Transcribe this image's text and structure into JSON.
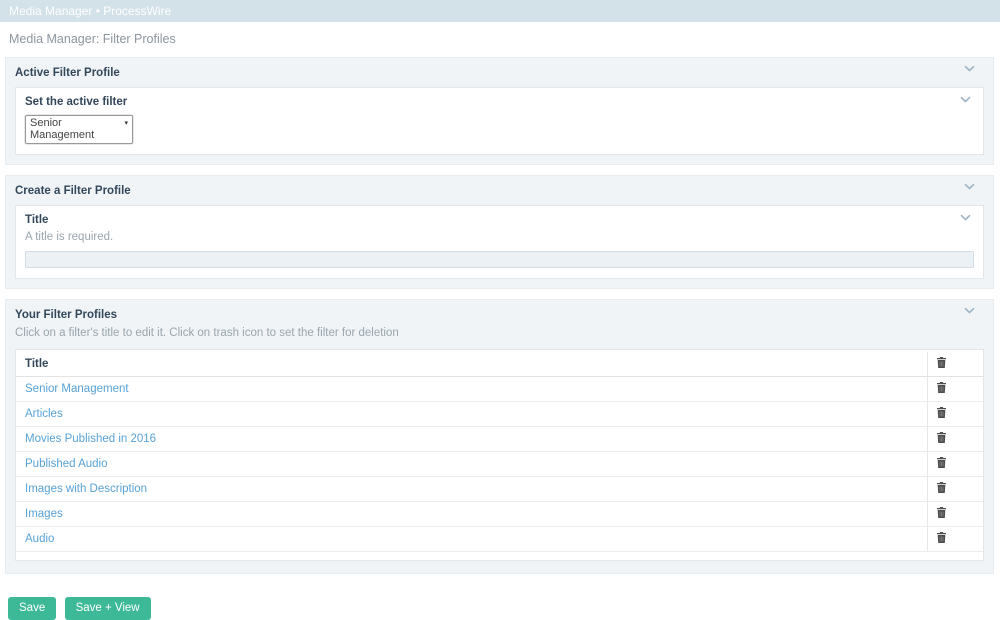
{
  "topbar": {
    "title": "Media Manager • ProcessWire"
  },
  "page": {
    "heading": "Media Manager: Filter Profiles"
  },
  "panels": {
    "active": {
      "title": "Active Filter Profile",
      "field_label": "Set the active filter",
      "select_value": "Senior Management"
    },
    "create": {
      "title": "Create a Filter Profile",
      "field_label": "Title",
      "field_note": "A title is required.",
      "input_value": ""
    },
    "profiles": {
      "title": "Your Filter Profiles",
      "description": "Click on a filter's title to edit it. Click on trash icon to set the filter for deletion",
      "table": {
        "title_header": "Title",
        "rows": [
          {
            "title": "Senior Management"
          },
          {
            "title": "Articles"
          },
          {
            "title": "Movies Published in 2016"
          },
          {
            "title": "Published Audio"
          },
          {
            "title": "Images with Description"
          },
          {
            "title": "Images"
          },
          {
            "title": "Audio"
          }
        ]
      }
    }
  },
  "buttons": {
    "save": "Save",
    "save_view": "Save + View"
  },
  "icons": {
    "chevron": "chevron-down-icon",
    "trash": "trash-icon",
    "select_arrow": "▾"
  },
  "colors": {
    "topbar_bg": "#d3e1e8",
    "panel_bg": "#f0f4f7",
    "navy_text": "#33475b",
    "muted_text": "#9aa5ad",
    "link_blue": "#58a2d6",
    "button_green": "#3eb998",
    "input_bg": "#ecf1f6"
  }
}
